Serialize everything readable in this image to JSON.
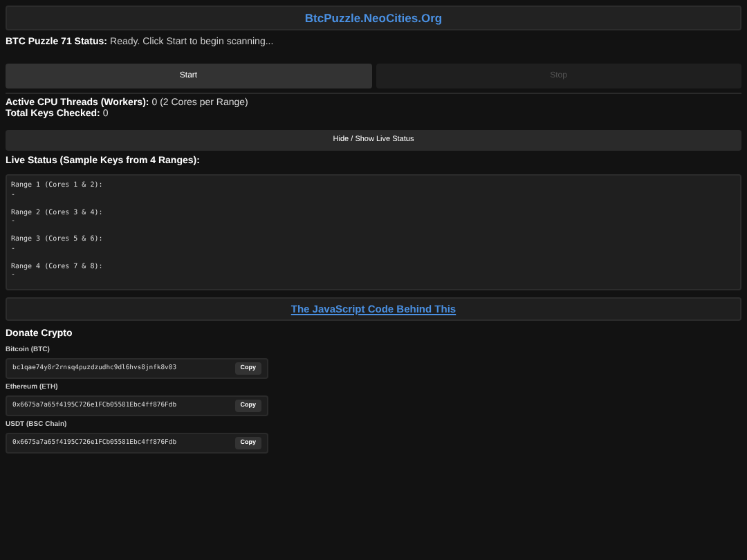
{
  "header": {
    "link": "BtcPuzzle.NeoCities.Org"
  },
  "status": {
    "label": "BTC Puzzle 71 Status:",
    "value": "Ready. Click Start to begin scanning..."
  },
  "buttons": [
    {
      "label": "Start",
      "disabled": false
    },
    {
      "label": "Stop",
      "disabled": true
    }
  ],
  "stats": [
    {
      "label": "Active CPU Threads (Workers):",
      "value": "0 (2 Cores per Range)"
    },
    {
      "label": "Total Keys Checked:",
      "value": "0"
    }
  ],
  "toggle_button": "Hide / Show Live Status",
  "live_status": {
    "title": "Live Status (Sample Keys from 4 Ranges):",
    "ranges": [
      {
        "label": "Range 1 (Cores 1 & 2):",
        "value": "-"
      },
      {
        "label": "Range 2 (Cores 3 & 4):",
        "value": "-"
      },
      {
        "label": "Range 3 (Cores 5 & 6):",
        "value": "-"
      },
      {
        "label": "Range 4 (Cores 7 & 8):",
        "value": "-"
      }
    ]
  },
  "code_link": "The JavaScript Code Behind This",
  "donate": {
    "title": "Donate Crypto",
    "wallets": [
      {
        "label": "Bitcoin (BTC)",
        "address": "bc1qae74y8r2rnsq4puzdzudhc9dl6hvs8jnfk8v03",
        "button": "Copy"
      },
      {
        "label": "Ethereum (ETH)",
        "address": "0x6675a7a65f4195C726e1FCb05581Ebc4ff876Fdb",
        "button": "Copy"
      },
      {
        "label": "USDT (BSC Chain)",
        "address": "0x6675a7a65f4195C726e1FCb05581Ebc4ff876Fdb",
        "button": "Copy"
      }
    ]
  }
}
